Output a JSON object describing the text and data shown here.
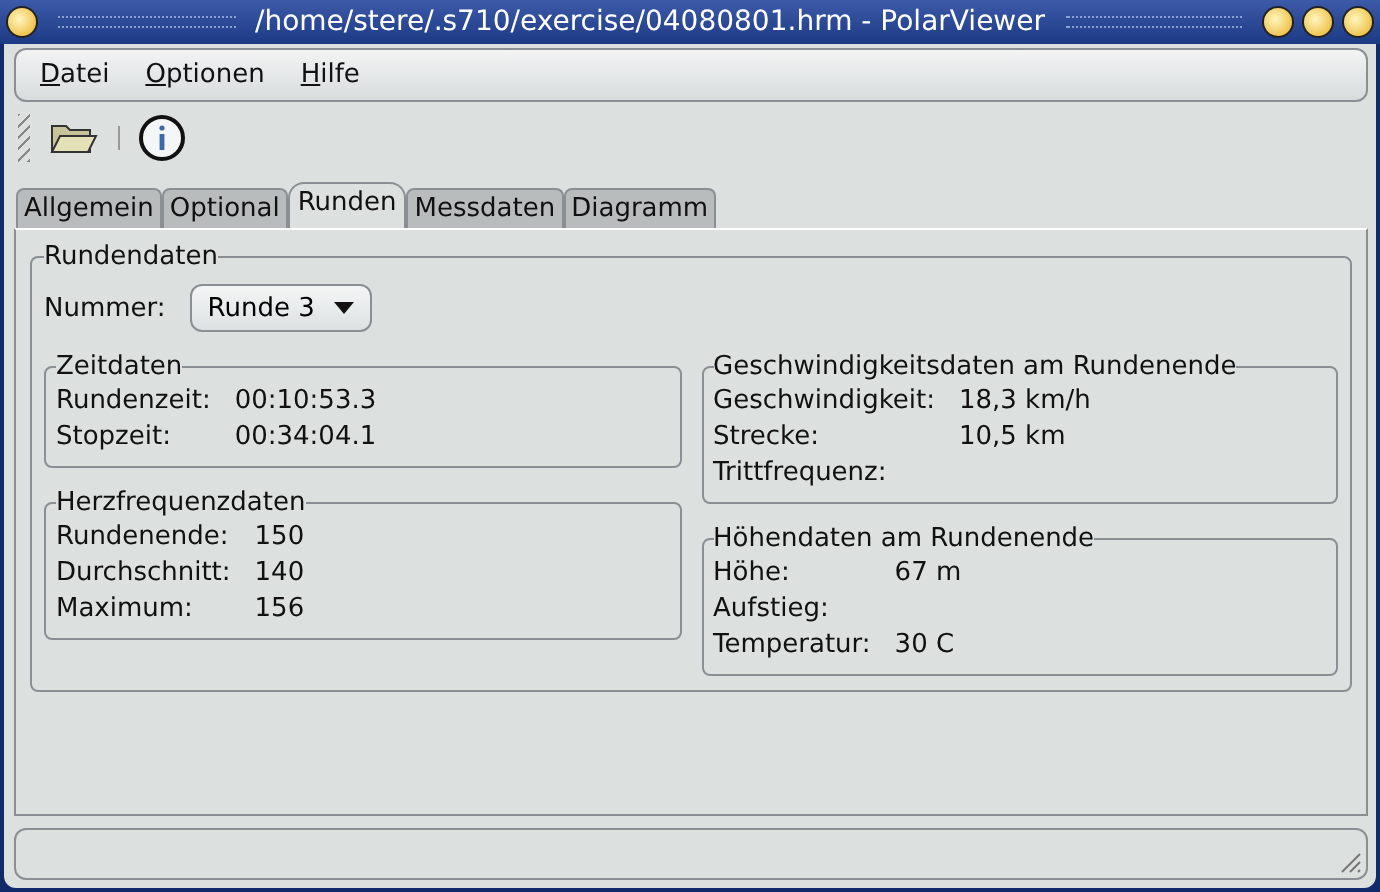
{
  "window": {
    "title": "/home/stere/.s710/exercise/04080801.hrm - PolarViewer"
  },
  "menu": [
    {
      "label": "Datei"
    },
    {
      "label": "Optionen"
    },
    {
      "label": "Hilfe"
    }
  ],
  "tabs": [
    {
      "label": "Allgemein",
      "selected": false
    },
    {
      "label": "Optional",
      "selected": false
    },
    {
      "label": "Runden",
      "selected": true
    },
    {
      "label": "Messdaten",
      "selected": false
    },
    {
      "label": "Diagramm",
      "selected": false
    }
  ],
  "lap_data": {
    "title": "Rundendaten",
    "number_label": "Nummer:",
    "number_value": "Runde 3",
    "left": [
      {
        "title": "Zeitdaten",
        "rows": [
          {
            "label": "Rundenzeit:",
            "value": "00:10:53.3"
          },
          {
            "label": "Stopzeit:",
            "value": "00:34:04.1"
          }
        ]
      },
      {
        "title": "Herzfrequenzdaten",
        "rows": [
          {
            "label": "Rundenende:",
            "value": "150"
          },
          {
            "label": "Durchschnitt:",
            "value": "140"
          },
          {
            "label": "Maximum:",
            "value": "156"
          }
        ]
      }
    ],
    "right": [
      {
        "title": "Geschwindigkeitsdaten am Rundenende",
        "rows": [
          {
            "label": "Geschwindigkeit:",
            "value": "18,3 km/h"
          },
          {
            "label": "Strecke:",
            "value": "10,5 km"
          },
          {
            "label": "Trittfrequenz:"
          }
        ]
      },
      {
        "title": "Höhendaten am Rundenende",
        "rows": [
          {
            "label": "Höhe:",
            "value": "67 m"
          },
          {
            "label": "Aufstieg:"
          },
          {
            "label": "Temperatur:",
            "value": "30 C"
          }
        ]
      }
    ]
  }
}
